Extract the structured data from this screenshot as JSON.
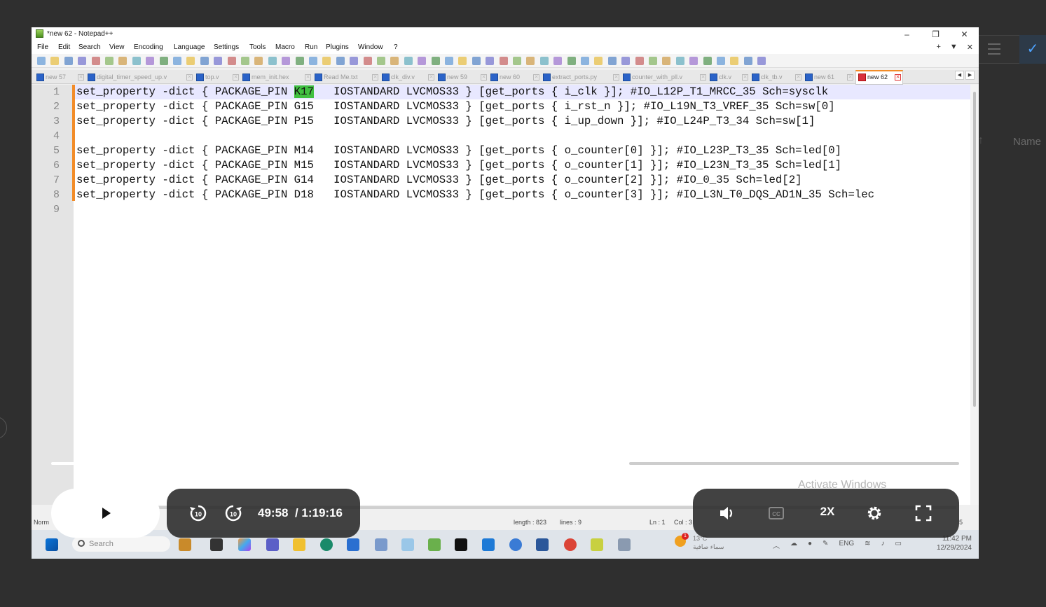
{
  "notepad": {
    "title": "*new 62 - Notepad++",
    "window_controls": [
      "–",
      "❐",
      "✕"
    ],
    "menu": [
      "File",
      "Edit",
      "Search",
      "View",
      "Encoding",
      "Language",
      "Settings",
      "Tools",
      "Macro",
      "Run",
      "Plugins",
      "Window",
      "?"
    ],
    "menu_right": [
      "+",
      "▼",
      "✕"
    ],
    "tabs": [
      {
        "label": "new 57"
      },
      {
        "label": "digital_timer_speed_up.v"
      },
      {
        "label": "top.v"
      },
      {
        "label": "mem_init.hex"
      },
      {
        "label": "Read Me.txt"
      },
      {
        "label": "clk_div.v"
      },
      {
        "label": "new 59"
      },
      {
        "label": "new 60"
      },
      {
        "label": "extract_ports.py"
      },
      {
        "label": "counter_with_pll.v"
      },
      {
        "label": "clk.v"
      },
      {
        "label": "clk_tb.v"
      },
      {
        "label": "new 61"
      },
      {
        "label": "new 62"
      }
    ],
    "line_numbers": [
      "1",
      "2",
      "3",
      "4",
      "5",
      "6",
      "7",
      "8",
      "9"
    ],
    "code_lines": [
      {
        "pre": "set_property -dict { PACKAGE_PIN ",
        "hl": "K17",
        "post": "   IOSTANDARD LVCMOS33 } [get_ports { i_clk }]; #IO_L12P_T1_MRCC_35 Sch=sysclk"
      },
      {
        "pre": "set_property -dict { PACKAGE_PIN G15   IOSTANDARD LVCMOS33 } [get_ports { i_rst_n }]; #IO_L19N_T3_VREF_35 Sch=sw[0]",
        "hl": "",
        "post": ""
      },
      {
        "pre": "set_property -dict { PACKAGE_PIN P15   IOSTANDARD LVCMOS33 } [get_ports { i_up_down }]; #IO_L24P_T3_34 Sch=sw[1]",
        "hl": "",
        "post": ""
      },
      {
        "pre": "",
        "hl": "",
        "post": ""
      },
      {
        "pre": "set_property -dict { PACKAGE_PIN M14   IOSTANDARD LVCMOS33 } [get_ports { o_counter[0] }]; #IO_L23P_T3_35 Sch=led[0]",
        "hl": "",
        "post": ""
      },
      {
        "pre": "set_property -dict { PACKAGE_PIN M15   IOSTANDARD LVCMOS33 } [get_ports { o_counter[1] }]; #IO_L23N_T3_35 Sch=led[1]",
        "hl": "",
        "post": ""
      },
      {
        "pre": "set_property -dict { PACKAGE_PIN G14   IOSTANDARD LVCMOS33 } [get_ports { o_counter[2] }]; #IO_0_35 Sch=led[2]",
        "hl": "",
        "post": ""
      },
      {
        "pre": "set_property -dict { PACKAGE_PIN D18   IOSTANDARD LVCMOS33 } [get_ports { o_counter[3] }]; #IO_L3N_T0_DQS_AD1N_35 Sch=lec",
        "hl": "",
        "post": ""
      },
      {
        "pre": "",
        "hl": "",
        "post": ""
      }
    ],
    "status": {
      "type": "Norm",
      "length": "length : 823",
      "lines": "lines : 9",
      "ln": "Ln : 1",
      "col": "Col : 3",
      "sel": "5"
    },
    "watermark": "Activate Windows"
  },
  "taskbar": {
    "search_placeholder": "Search",
    "weather_temp": "13°C",
    "weather_desc": "سماء صافية",
    "weather_badge": "1",
    "lang": "ENG",
    "time": "11:42 PM",
    "date": "12/29/2024"
  },
  "video": {
    "current_time": "49:58",
    "separator": "/",
    "duration": "1:19:16",
    "speed": "2X",
    "progress_fraction": 0.63,
    "rewind_label": "10",
    "forward_label": "10"
  },
  "background": {
    "name_label": "Name"
  }
}
